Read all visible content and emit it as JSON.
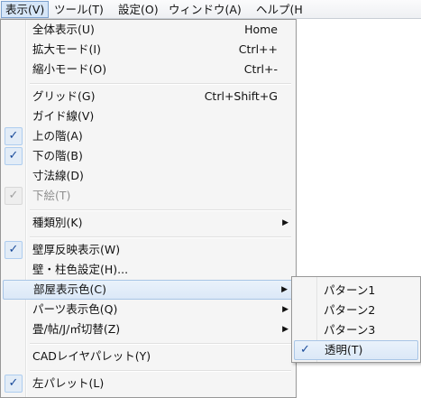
{
  "menubar": {
    "items": [
      {
        "label": "表示(V)",
        "active": true
      },
      {
        "label": "ツール(T)"
      },
      {
        "label": "設定(O)"
      },
      {
        "label": "ウィンドウ(A)"
      },
      {
        "label": "ヘルプ(H"
      }
    ]
  },
  "view_menu": {
    "items": [
      {
        "label": "全体表示(U)",
        "shortcut": "Home"
      },
      {
        "label": "拡大モード(I)",
        "shortcut": "Ctrl++"
      },
      {
        "label": "縮小モード(O)",
        "shortcut": "Ctrl+-"
      },
      {
        "label": "グリッド(G)",
        "shortcut": "Ctrl+Shift+G"
      },
      {
        "label": "ガイド線(V)"
      },
      {
        "label": "上の階(A)",
        "checked": true
      },
      {
        "label": "下の階(B)",
        "checked": true
      },
      {
        "label": "寸法線(D)"
      },
      {
        "label": "下絵(T)",
        "checked": true,
        "disabled": true
      },
      {
        "label": "種類別(K)",
        "submenu_arrow": "▶"
      },
      {
        "label": "壁厚反映表示(W)",
        "checked": true
      },
      {
        "label": "壁・柱色設定(H)..."
      },
      {
        "label": "部屋表示色(C)",
        "submenu_arrow": "▶",
        "highlighted": true
      },
      {
        "label": "パーツ表示色(Q)",
        "submenu_arrow": "▶"
      },
      {
        "label": "畳/帖/J/㎡切替(Z)",
        "submenu_arrow": "▶"
      },
      {
        "label": "CADレイヤパレット(Y)"
      },
      {
        "label": "左パレット(L)",
        "checked": true
      }
    ]
  },
  "room_color_submenu": {
    "items": [
      {
        "label": "パターン1"
      },
      {
        "label": "パターン2"
      },
      {
        "label": "パターン3"
      },
      {
        "label": "透明(T)",
        "checked": true,
        "highlighted": true
      }
    ]
  },
  "icons": {
    "check": "✓",
    "arrow": "▶"
  },
  "colors": {
    "highlight_border": "#a8c5e6",
    "highlight_fill": "#dbe8f7",
    "check_color": "#1a4b9a",
    "menu_bg": "#f5f5f5"
  }
}
